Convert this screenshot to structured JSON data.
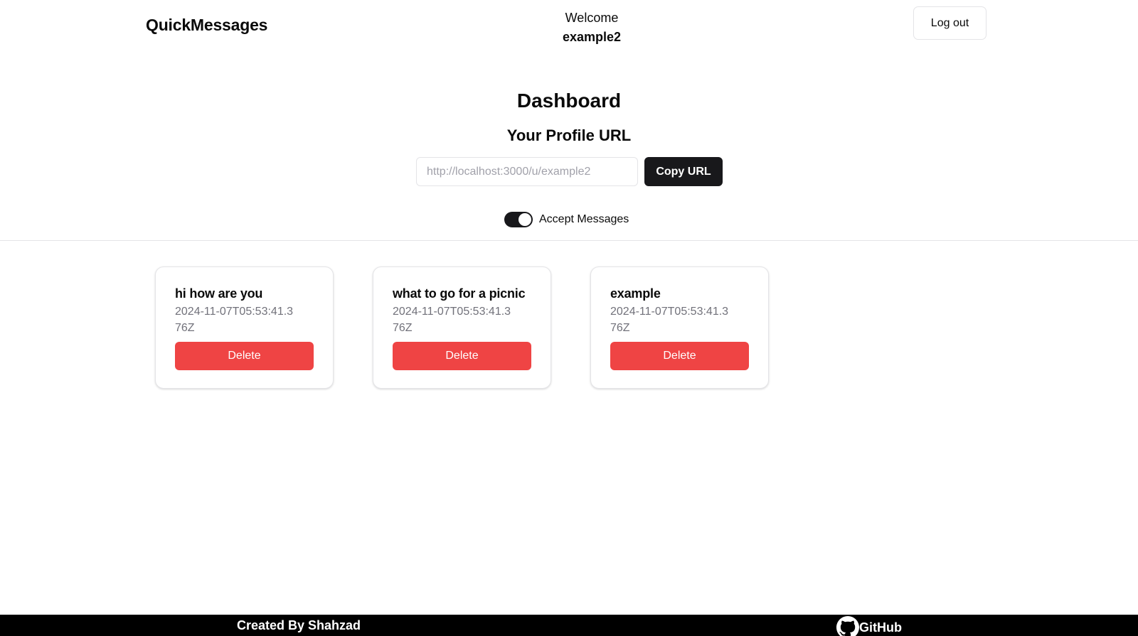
{
  "header": {
    "brand": "QuickMessages",
    "welcome_text": "Welcome",
    "username": "example2",
    "logout_label": "Log out"
  },
  "dashboard": {
    "title": "Dashboard",
    "profile_url_heading": "Your Profile URL",
    "profile_url_placeholder": "http://localhost:3000/u/example2",
    "copy_label": "Copy URL",
    "accept_messages_label": "Accept Messages",
    "accept_messages_on": true
  },
  "messages": [
    {
      "content": "hi how are you",
      "created_at": "2024-11-07T05:53:41.376Z",
      "delete_label": "Delete"
    },
    {
      "content": "what to go for a picnic",
      "created_at": "2024-11-07T05:53:41.376Z",
      "delete_label": "Delete"
    },
    {
      "content": "example",
      "created_at": "2024-11-07T05:53:41.376Z",
      "delete_label": "Delete"
    }
  ],
  "footer": {
    "credit": "Created By Shahzad",
    "github_label": "GitHub",
    "github_icon": "github-icon"
  },
  "colors": {
    "primary": "#18181b",
    "destructive": "#ef4444",
    "muted_text": "#71717a",
    "border": "#e4e4e7",
    "footer_bg": "#000000"
  }
}
